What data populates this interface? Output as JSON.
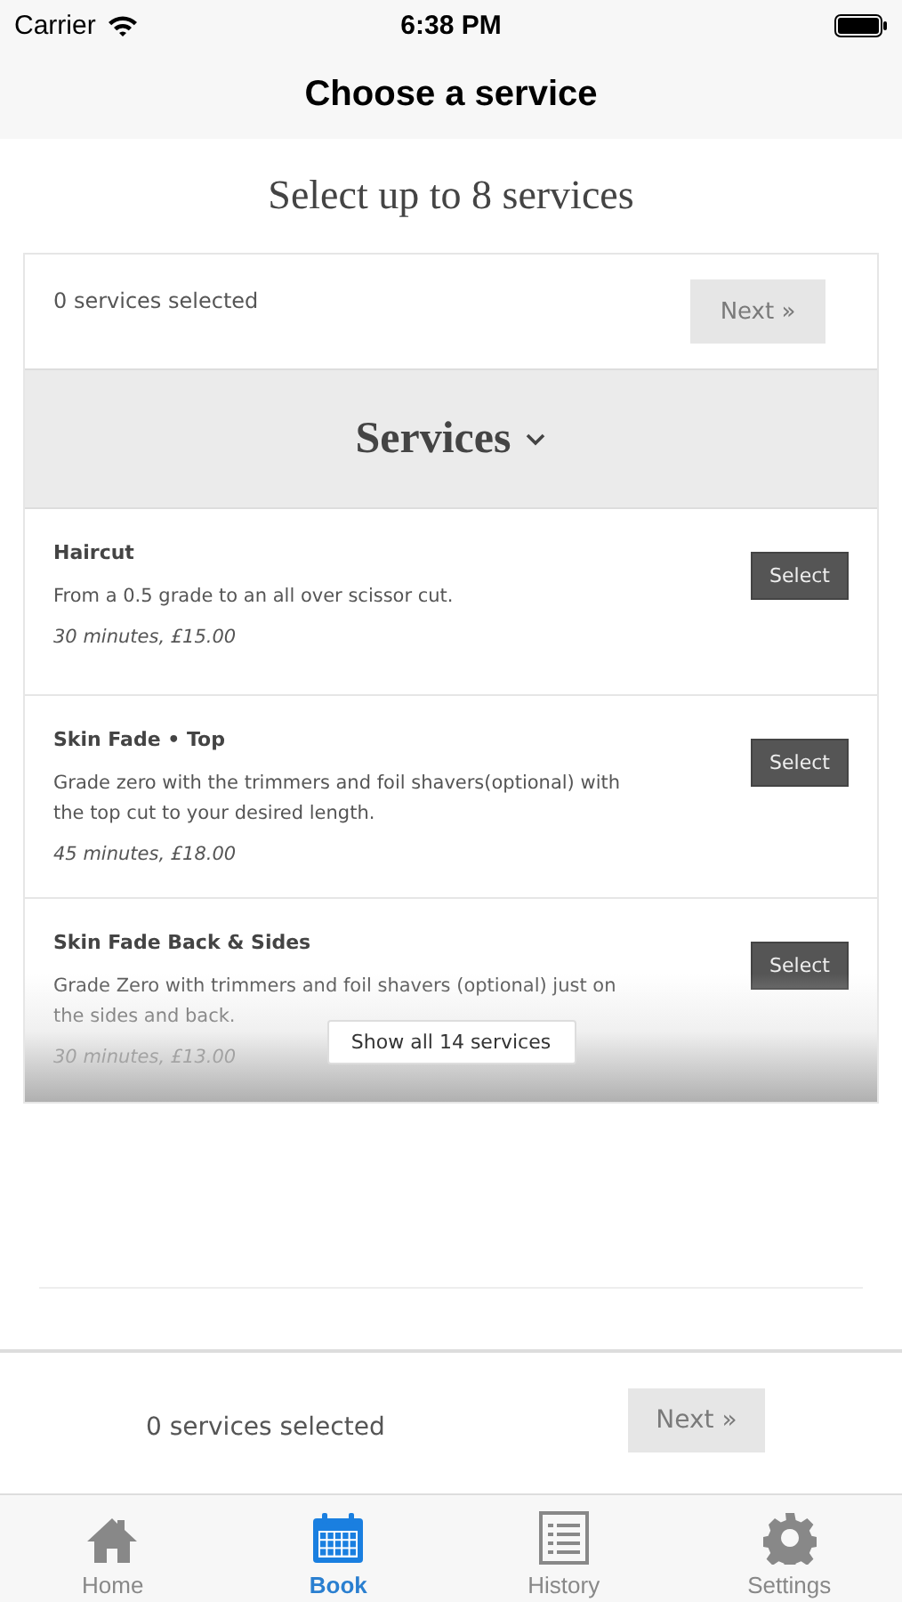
{
  "status_bar": {
    "carrier": "Carrier",
    "time": "6:38 PM"
  },
  "nav": {
    "title": "Choose a service"
  },
  "heading": "Select up to 8 services",
  "summary": {
    "text": "0 services selected",
    "next": {
      "label": "Next »",
      "disabled": true
    }
  },
  "section": {
    "title": "Services",
    "expanded": true
  },
  "services": [
    {
      "name": "Haircut",
      "description": "From a 0.5 grade to an all over scissor cut.",
      "details": "30 minutes, £15.00",
      "button": "Select"
    },
    {
      "name": "Skin Fade • Top",
      "description": "Grade zero with the trimmers and foil shavers(optional) with the top cut to your desired length.",
      "details": "45 minutes, £18.00",
      "button": "Select"
    },
    {
      "name": "Skin Fade Back & Sides",
      "description": "Grade Zero with trimmers and foil shavers (optional) just on the sides and back.",
      "details": "30 minutes, £13.00",
      "button": "Select"
    }
  ],
  "show_all": "Show all 14 services",
  "footer": {
    "text": "0 services selected",
    "next": {
      "label": "Next »",
      "disabled": true
    }
  },
  "tabs": [
    {
      "label": "Home",
      "selected": false
    },
    {
      "label": "Book",
      "selected": true
    },
    {
      "label": "History",
      "selected": false
    },
    {
      "label": "Settings",
      "selected": false
    }
  ]
}
